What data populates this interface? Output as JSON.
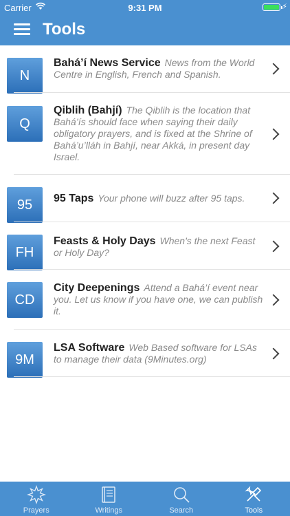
{
  "status": {
    "carrier": "Carrier",
    "time": "9:31 PM"
  },
  "header": {
    "title": "Tools"
  },
  "items": [
    {
      "badge": "N",
      "title": "Bahá’í News Service",
      "desc": "News from the World Centre in English, French and Spanish."
    },
    {
      "badge": "Q",
      "title": "Qiblih (Bahjí)",
      "desc": "The Qiblih is the location that Bahá’ís should face when saying their daily obligatory prayers, and is fixed at the Shrine of Bahá’u’lláh in Bahjí, near Akká, in present day Israel."
    },
    {
      "badge": "95",
      "title": "95 Taps",
      "desc": "Your phone will buzz after 95 taps."
    },
    {
      "badge": "FH",
      "title": "Feasts & Holy Days",
      "desc": "When's the next Feast or Holy Day?"
    },
    {
      "badge": "CD",
      "title": "City Deepenings",
      "desc": "Attend a Bahá’í event near you. Let us know if you have one, we can publish it."
    },
    {
      "badge": "9M",
      "title": "LSA Software",
      "desc": "Web Based software for LSAs to manage their data (9Minutes.org)"
    }
  ],
  "tabs": [
    {
      "label": "Prayers",
      "icon": "star-burst-icon"
    },
    {
      "label": "Writings",
      "icon": "book-icon"
    },
    {
      "label": "Search",
      "icon": "search-icon"
    },
    {
      "label": "Tools",
      "icon": "tools-icon"
    }
  ],
  "colors": {
    "accent": "#4a90d0",
    "badge": "#3b7fc4"
  }
}
